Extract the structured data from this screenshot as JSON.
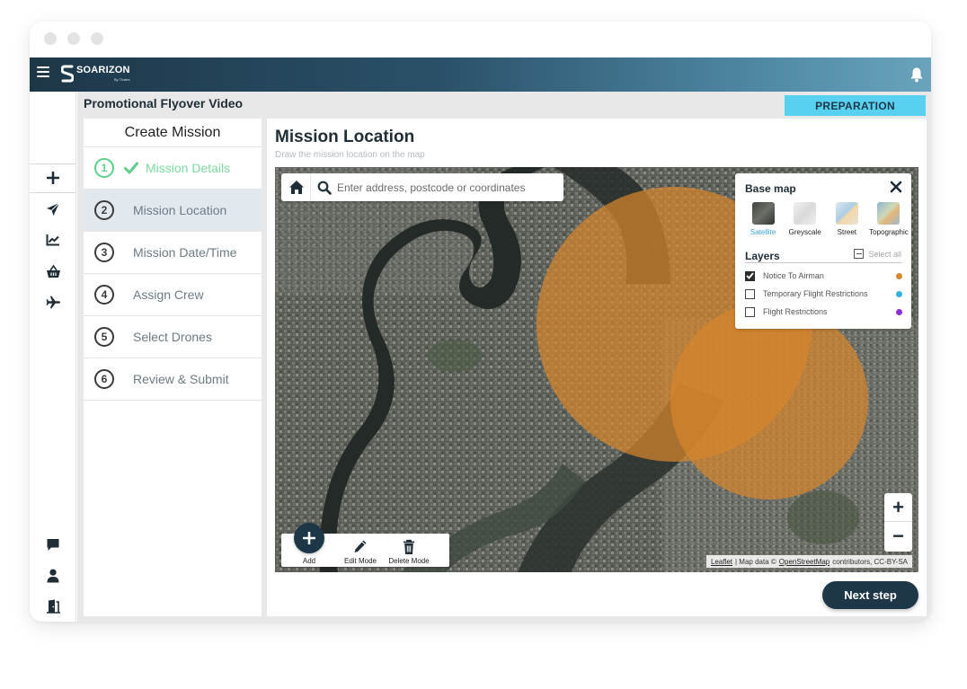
{
  "app": {
    "brand": "SOARIZON",
    "brand_sub": "By Thales"
  },
  "sidebar": {
    "items": [
      {
        "icon": "plus-icon"
      },
      {
        "icon": "paper-plane-icon"
      },
      {
        "icon": "chart-icon"
      },
      {
        "icon": "basket-icon"
      },
      {
        "icon": "airplane-icon"
      },
      {
        "icon": "chat-icon"
      },
      {
        "icon": "user-icon"
      },
      {
        "icon": "logout-icon"
      }
    ]
  },
  "header": {
    "mission_name": "Promotional Flyover Video",
    "phase": "PREPARATION"
  },
  "steps": {
    "title": "Create Mission",
    "items": [
      {
        "num": "1",
        "label": "Mission Details",
        "state": "done"
      },
      {
        "num": "2",
        "label": "Mission Location",
        "state": "active"
      },
      {
        "num": "3",
        "label": "Mission Date/Time",
        "state": "pending"
      },
      {
        "num": "4",
        "label": "Assign Crew",
        "state": "pending"
      },
      {
        "num": "5",
        "label": "Select Drones",
        "state": "pending"
      },
      {
        "num": "6",
        "label": "Review & Submit",
        "state": "pending"
      }
    ]
  },
  "main": {
    "title": "Mission Location",
    "subtitle": "Draw the mission location on the map",
    "next_label": "Next step"
  },
  "map": {
    "search_placeholder": "Enter address, postcode or coordinates",
    "layer_panel": {
      "base_map_title": "Base map",
      "base_maps": [
        {
          "label": "Satellite",
          "selected": true
        },
        {
          "label": "Greyscale",
          "selected": false
        },
        {
          "label": "Street",
          "selected": false
        },
        {
          "label": "Topographic",
          "selected": false
        }
      ],
      "layers_title": "Layers",
      "select_all_label": "Select all",
      "layers": [
        {
          "label": "Notice To Airman",
          "checked": true,
          "color": "#d58a2e"
        },
        {
          "label": "Temporary Flight Restrictions",
          "checked": false,
          "color": "#33b3dc"
        },
        {
          "label": "Flight Restrictions",
          "checked": false,
          "color": "#8e2fd8"
        }
      ]
    },
    "toolbar": {
      "add_label": "Add",
      "edit_label": "Edit Mode",
      "delete_label": "Delete Mode"
    },
    "zoom": {
      "in": "+",
      "out": "−"
    },
    "attribution": {
      "leaflet": "Leaflet",
      "mid": "| Map data ©",
      "osm": "OpenStreetMap",
      "tail": "contributors, CC-BY-SA"
    },
    "overlay_color": "#d7852d"
  },
  "colors": {
    "navy": "#1d3748",
    "cyan_badge": "#58d1f1",
    "done_green": "#5ecf8a"
  }
}
